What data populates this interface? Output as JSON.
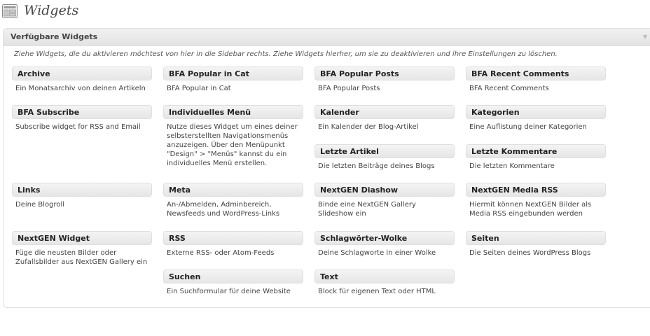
{
  "page": {
    "title": "Widgets",
    "icon": "widgets-icon"
  },
  "panel": {
    "title": "Verfügbare Widgets",
    "description": "Ziehe Widgets, die du aktivieren möchtest von hier in die Sidebar rechts. Ziehe Widgets hierher, um sie zu deaktivieren und ihre Einstellungen zu löschen.",
    "toggle_icon": "triangle-down-icon"
  },
  "widgets": [
    {
      "name": "Archive",
      "desc": "Ein Monatsarchiv von deinen Artikeln"
    },
    {
      "name": "BFA Popular in Cat",
      "desc": "BFA Popular in Cat"
    },
    {
      "name": "BFA Popular Posts",
      "desc": "BFA Popular Posts"
    },
    {
      "name": "BFA Recent Comments",
      "desc": "BFA Recent Comments"
    },
    {
      "name": "BFA Subscribe",
      "desc": "Subscribe widget for RSS and Email"
    },
    {
      "name": "Individuelles Menü",
      "desc": "Nutze dieses Widget um eines deiner selbsterstellten Navigationsmenüs anzuzeigen. Über den Menüpunkt \"Design\" > \"Menüs\" kannst du ein individuelles Menü erstellen."
    },
    {
      "name": "Kalender",
      "desc": "Ein Kalender der Blog-Artikel"
    },
    {
      "name": "Kategorien",
      "desc": "Eine Auflistung deiner Kategorien"
    },
    {
      "name": "Letzte Artikel",
      "desc": "Die letzten Beiträge deines Blogs"
    },
    {
      "name": "Letzte Kommentare",
      "desc": "Die letzten Kommentare"
    },
    {
      "name": "Links",
      "desc": "Deine Blogroll"
    },
    {
      "name": "Meta",
      "desc": "An-/Abmelden, Adminbereich, Newsfeeds und WordPress-Links"
    },
    {
      "name": "NextGEN Diashow",
      "desc": "Binde eine NextGEN Gallery Slideshow ein"
    },
    {
      "name": "NextGEN Media RSS",
      "desc": "Hiermit können NextGEN Bilder als Media RSS eingebunden werden"
    },
    {
      "name": "NextGEN Widget",
      "desc": "Füge die neusten Bilder oder Zufallsbilder aus NextGEN Gallery ein"
    },
    {
      "name": "RSS",
      "desc": "Externe RSS- oder Atom-Feeds"
    },
    {
      "name": "Schlagwörter-Wolke",
      "desc": "Deine Schlagworte in einer Wolke"
    },
    {
      "name": "Seiten",
      "desc": "Die Seiten deines WordPress Blogs"
    },
    {
      "name": "Suchen",
      "desc": "Ein Suchformular für deine Website"
    },
    {
      "name": "Text",
      "desc": "Block für eigenen Text oder HTML"
    }
  ]
}
